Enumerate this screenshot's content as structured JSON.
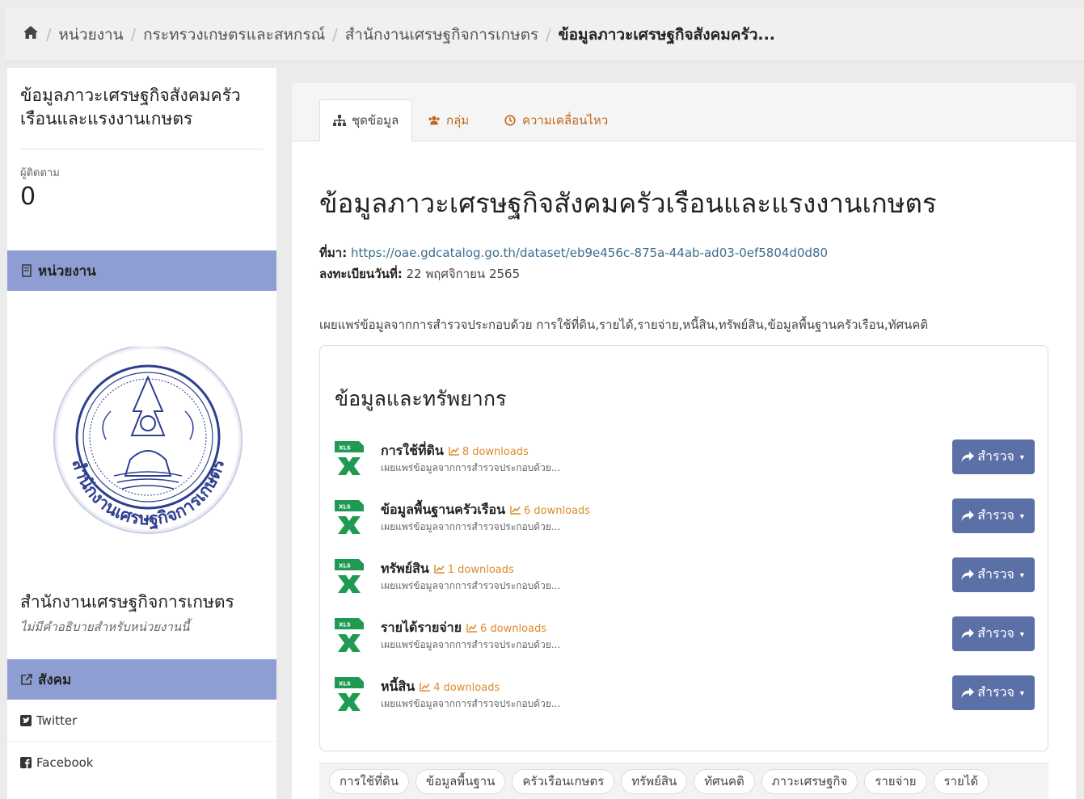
{
  "breadcrumb": {
    "items": [
      "หน่วยงาน",
      "กระทรวงเกษตรและสหกรณ์",
      "สำนักงานเศรษฐกิจการเกษตร",
      "ข้อมูลภาวะเศรษฐกิจสังคมครัว..."
    ]
  },
  "sidebar": {
    "title": "ข้อมูลภาวะเศรษฐกิจสังคมครัวเรือนและแรงงานเกษตร",
    "followers_label": "ผู้ติดตาม",
    "followers_count": "0",
    "org_section": "หน่วยงาน",
    "logo_text": "สำนักงานเศรษฐกิจการเกษตร",
    "org_name": "สำนักงานเศรษฐกิจการเกษตร",
    "org_desc": "ไม่มีคำอธิบายสำหรับหน่วยงานนี้",
    "social_section": "สังคม",
    "twitter": "Twitter",
    "facebook": "Facebook"
  },
  "tabs": [
    {
      "label": "ชุดข้อมูล"
    },
    {
      "label": "กลุ่ม"
    },
    {
      "label": "ความเคลื่อนไหว"
    }
  ],
  "dataset": {
    "title": "ข้อมูลภาวะเศรษฐกิจสังคมครัวเรือนและแรงงานเกษตร",
    "source_label": "ที่มา:",
    "source_url": "https://oae.gdcatalog.go.th/dataset/eb9e456c-875a-44ab-ad03-0ef5804d0d80",
    "registered_label": "ลงทะเบียนวันที่:",
    "registered_date": "22 พฤศจิกายน 2565",
    "description": "เผยแพร่ข้อมูลจากการสำรวจประกอบด้วย การใช้ที่ดิน,รายได้,รายจ่าย,หนี้สิน,ทรัพย์สิน,ข้อมูลพื้นฐานครัวเรือน,ทัศนคติ"
  },
  "resources": {
    "title": "ข้อมูลและทรัพยากร",
    "file_badge": "XLS",
    "explore_label": "สำรวจ",
    "items": [
      {
        "name": "การใช้ที่ดิน",
        "downloads": "8 downloads",
        "desc": "เผยแพร่ข้อมูลจากการสำรวจประกอบด้วย..."
      },
      {
        "name": "ข้อมูลพื้นฐานครัวเรือน",
        "downloads": "6 downloads",
        "desc": "เผยแพร่ข้อมูลจากการสำรวจประกอบด้วย..."
      },
      {
        "name": "ทรัพย์สิน",
        "downloads": "1 downloads",
        "desc": "เผยแพร่ข้อมูลจากการสำรวจประกอบด้วย..."
      },
      {
        "name": "รายได้รายจ่าย",
        "downloads": "6 downloads",
        "desc": "เผยแพร่ข้อมูลจากการสำรวจประกอบด้วย..."
      },
      {
        "name": "หนี้สิน",
        "downloads": "4 downloads",
        "desc": "เผยแพร่ข้อมูลจากการสำรวจประกอบด้วย..."
      }
    ]
  },
  "tags": [
    "การใช้ที่ดิน",
    "ข้อมูลพื้นฐาน",
    "ครัวเรือนเกษตร",
    "ทรัพย์สิน",
    "ทัศนคติ",
    "ภาวะเศรษฐกิจ",
    "รายจ่าย",
    "รายได้"
  ],
  "colors": {
    "accent": "#5c70a8",
    "section_bg": "#8e9ed2",
    "download": "#e08a2a",
    "tab_link": "#c0671c"
  }
}
